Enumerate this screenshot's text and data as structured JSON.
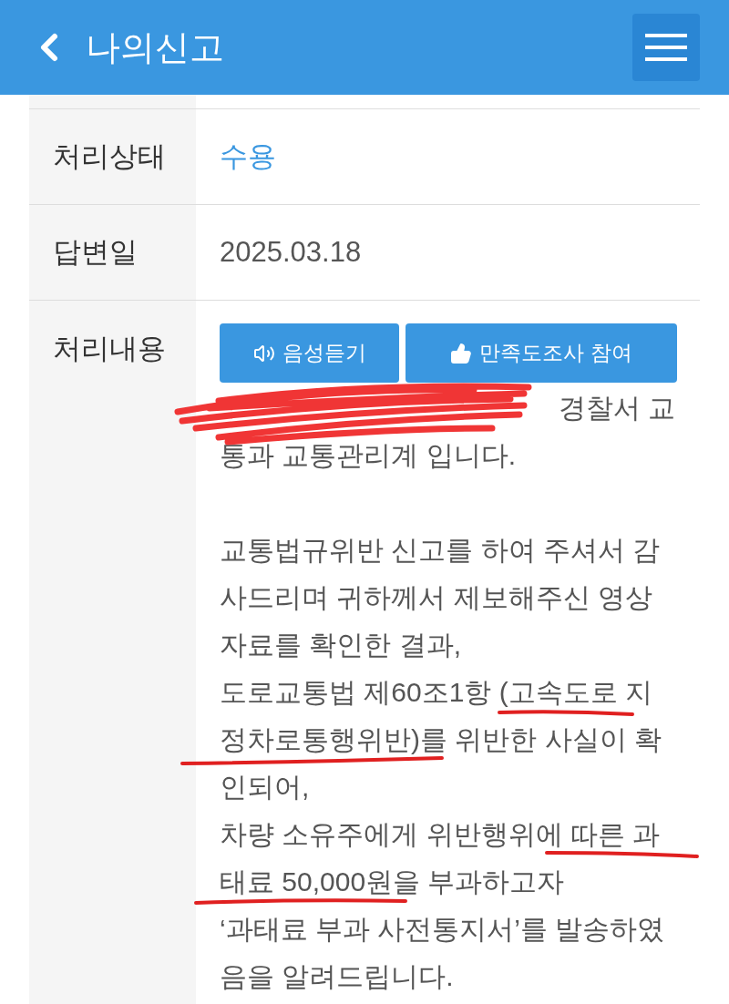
{
  "header": {
    "title": "나의신고"
  },
  "rows": [
    {
      "label": "처리상태",
      "value": "수용",
      "kind": "status"
    },
    {
      "label": "답변일",
      "value": "2025.03.18",
      "kind": "text"
    }
  ],
  "content": {
    "label": "처리내용",
    "buttons": [
      {
        "label": "음성듣기",
        "kind": "listen"
      },
      {
        "label": "만족도조사 참여",
        "kind": "survey"
      }
    ],
    "partial_line": "경찰서 교",
    "paragraphs": [
      [
        "통과 교통관리계 입니다."
      ],
      [
        "교통법규위반 신고를 하여 주셔서 감",
        "사드리며 귀하께서 제보해주신 영상",
        "자료를 확인한 결과,",
        "도로교통법 제60조1항 (고속도로 지",
        "정차로통행위반)를 위반한 사실이 확",
        "인되어,",
        "차량 소유주에게 위반행위에 따른 과",
        "태료 50,000원을 부과하고자",
        "‘과태료 부과 사전통지서’를 발송하였",
        "음을 알려드립니다."
      ]
    ]
  }
}
